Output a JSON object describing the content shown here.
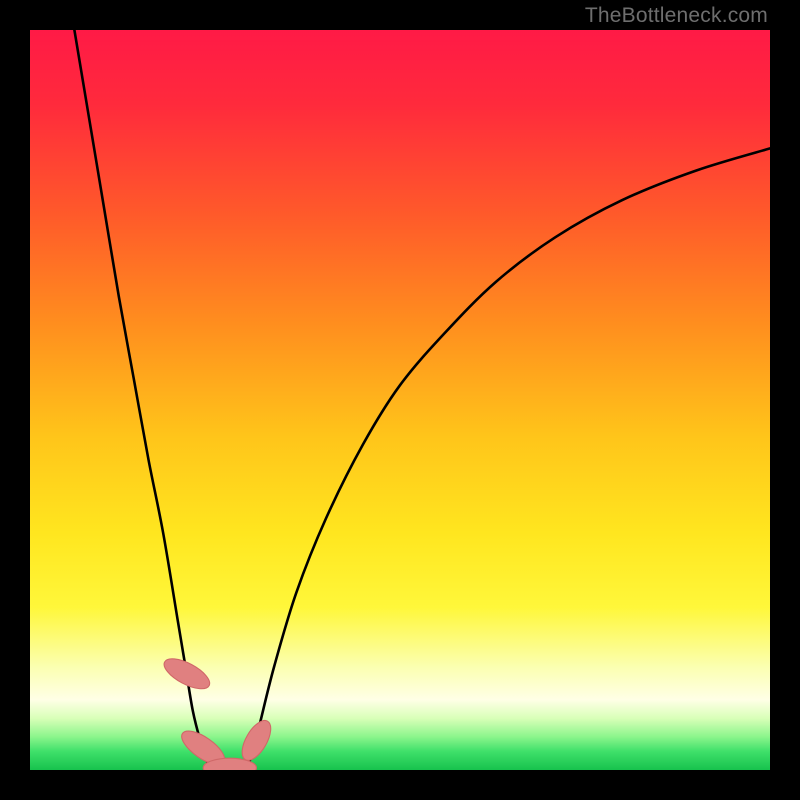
{
  "watermark": "TheBottleneck.com",
  "colors": {
    "frame": "#000000",
    "gradient_stops": [
      {
        "offset": 0.0,
        "color": "#ff1a46"
      },
      {
        "offset": 0.1,
        "color": "#ff2a3c"
      },
      {
        "offset": 0.25,
        "color": "#ff5a2a"
      },
      {
        "offset": 0.4,
        "color": "#ff8f1e"
      },
      {
        "offset": 0.55,
        "color": "#ffc51a"
      },
      {
        "offset": 0.68,
        "color": "#ffe61f"
      },
      {
        "offset": 0.78,
        "color": "#fff73a"
      },
      {
        "offset": 0.86,
        "color": "#fbffb0"
      },
      {
        "offset": 0.905,
        "color": "#ffffe6"
      },
      {
        "offset": 0.93,
        "color": "#d9ffb8"
      },
      {
        "offset": 0.955,
        "color": "#8cf58c"
      },
      {
        "offset": 0.975,
        "color": "#3fe06a"
      },
      {
        "offset": 1.0,
        "color": "#17c24d"
      }
    ],
    "curve": "#000000",
    "marker_fill": "#e08080",
    "marker_stroke": "#d06868"
  },
  "chart_data": {
    "type": "line",
    "title": "",
    "xlabel": "",
    "ylabel": "",
    "xlim": [
      0,
      100
    ],
    "ylim": [
      0,
      100
    ],
    "grid": false,
    "legend": false,
    "series": [
      {
        "name": "left-branch",
        "x": [
          6,
          8,
          10,
          12,
          14,
          16,
          18,
          20,
          21,
          22,
          23,
          24,
          25
        ],
        "y": [
          100,
          88,
          76,
          64,
          53,
          42,
          32,
          20,
          14,
          8,
          4,
          1,
          0
        ]
      },
      {
        "name": "right-branch",
        "x": [
          29,
          30,
          31,
          33,
          36,
          40,
          45,
          50,
          56,
          63,
          71,
          80,
          90,
          100
        ],
        "y": [
          0,
          2,
          6,
          14,
          24,
          34,
          44,
          52,
          59,
          66,
          72,
          77,
          81,
          84
        ]
      }
    ],
    "flat_bottom": {
      "x": [
        25,
        29
      ],
      "y": [
        0,
        0
      ]
    },
    "markers": [
      {
        "cx": 21.2,
        "cy": 13.0,
        "rx": 1.4,
        "ry": 3.4,
        "angle": -62
      },
      {
        "cx": 23.4,
        "cy": 3.0,
        "rx": 1.4,
        "ry": 3.4,
        "angle": -55
      },
      {
        "cx": 27.0,
        "cy": 0.3,
        "rx": 3.6,
        "ry": 1.3,
        "angle": 0
      },
      {
        "cx": 30.6,
        "cy": 4.0,
        "rx": 1.4,
        "ry": 3.0,
        "angle": 30
      }
    ]
  }
}
